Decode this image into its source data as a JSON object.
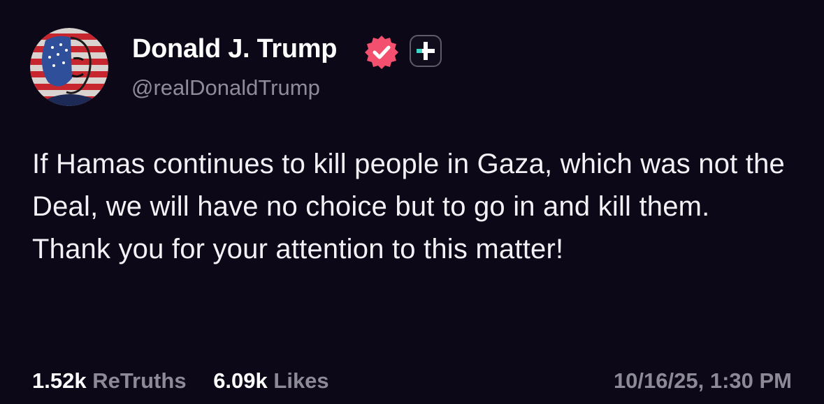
{
  "author": {
    "display_name": "Donald J. Trump",
    "handle": "@realDonaldTrump",
    "verified_icon": "verified-badge-icon",
    "plus_icon": "truth-plus-icon",
    "verified_color": "#f2506e",
    "plus_color": "#3fd8c8"
  },
  "post": {
    "text": "If Hamas continues to kill people in Gaza, which was not the Deal, we will have no choice but to go in and kill them. Thank you for your attention to this matter!"
  },
  "stats": {
    "retruths_count": "1.52k",
    "retruths_label": "ReTruths",
    "likes_count": "6.09k",
    "likes_label": "Likes"
  },
  "timestamp": "10/16/25, 1:30 PM",
  "colors": {
    "background": "#0c0818",
    "text": "#ffffff",
    "muted": "#8d8a98"
  }
}
